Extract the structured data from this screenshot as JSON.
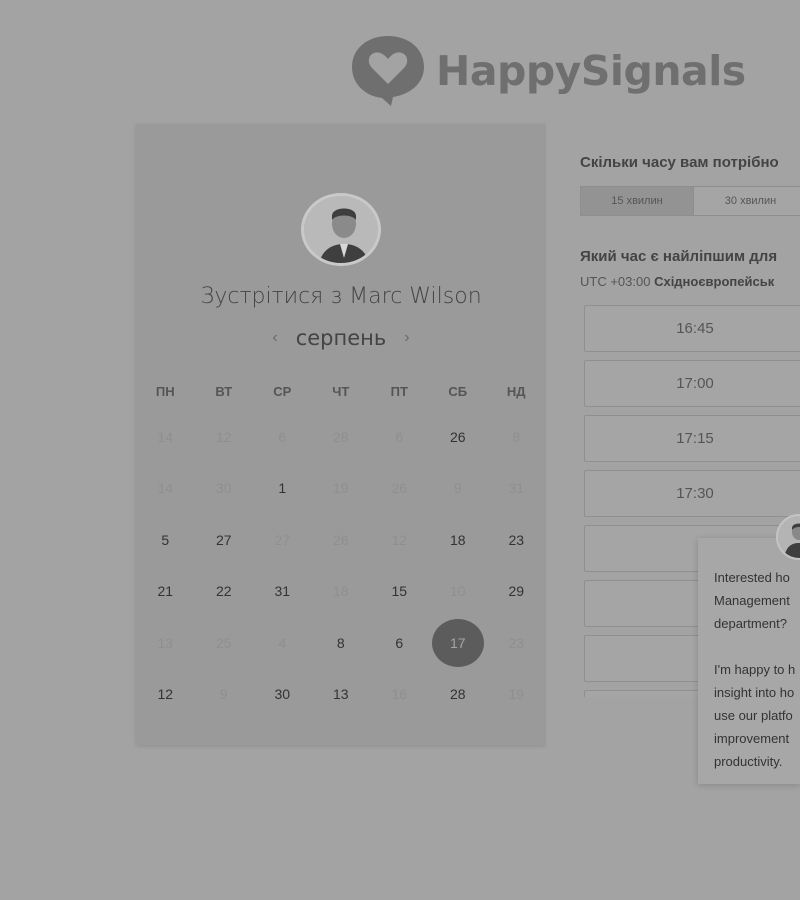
{
  "brand": {
    "name": "HappySignals"
  },
  "booking": {
    "title": "Зустрітися з Marc Wilson",
    "month": "серпень",
    "prev_icon": "chevron-left-icon",
    "next_icon": "chevron-right-icon",
    "weekdays": [
      "ПН",
      "ВТ",
      "СР",
      "ЧТ",
      "ПТ",
      "СБ",
      "НД"
    ],
    "weeks": [
      [
        {
          "d": "14",
          "s": "muted"
        },
        {
          "d": "12",
          "s": "muted"
        },
        {
          "d": "6",
          "s": "muted"
        },
        {
          "d": "28",
          "s": "muted"
        },
        {
          "d": "6",
          "s": "muted"
        },
        {
          "d": "26",
          "s": "active"
        },
        {
          "d": "8",
          "s": "muted"
        }
      ],
      [
        {
          "d": "14",
          "s": "muted"
        },
        {
          "d": "30",
          "s": "muted"
        },
        {
          "d": "1",
          "s": "active"
        },
        {
          "d": "19",
          "s": "muted"
        },
        {
          "d": "26",
          "s": "muted"
        },
        {
          "d": "9",
          "s": "muted"
        },
        {
          "d": "31",
          "s": "muted"
        }
      ],
      [
        {
          "d": "5",
          "s": "active"
        },
        {
          "d": "27",
          "s": "active"
        },
        {
          "d": "27",
          "s": "muted"
        },
        {
          "d": "26",
          "s": "muted"
        },
        {
          "d": "12",
          "s": "muted"
        },
        {
          "d": "18",
          "s": "active"
        },
        {
          "d": "23",
          "s": "active"
        }
      ],
      [
        {
          "d": "21",
          "s": "active"
        },
        {
          "d": "22",
          "s": "active"
        },
        {
          "d": "31",
          "s": "active"
        },
        {
          "d": "18",
          "s": "muted"
        },
        {
          "d": "15",
          "s": "active"
        },
        {
          "d": "10",
          "s": "muted"
        },
        {
          "d": "29",
          "s": "active"
        }
      ],
      [
        {
          "d": "13",
          "s": "muted"
        },
        {
          "d": "25",
          "s": "muted"
        },
        {
          "d": "4",
          "s": "muted"
        },
        {
          "d": "8",
          "s": "active"
        },
        {
          "d": "6",
          "s": "active"
        },
        {
          "d": "17",
          "s": "selected"
        },
        {
          "d": "23",
          "s": "muted"
        }
      ],
      [
        {
          "d": "12",
          "s": "active"
        },
        {
          "d": "9",
          "s": "muted"
        },
        {
          "d": "30",
          "s": "active"
        },
        {
          "d": "13",
          "s": "active"
        },
        {
          "d": "16",
          "s": "muted"
        },
        {
          "d": "28",
          "s": "active"
        },
        {
          "d": "19",
          "s": "muted"
        }
      ]
    ]
  },
  "schedule": {
    "duration_question": "Скільки часу вам потрібно",
    "durations": [
      "15 хвилин",
      "30 хвилин"
    ],
    "selected_duration": 0,
    "time_question": "Який час є найліпшим для",
    "timezone_offset": "UTC +03:00",
    "timezone_name": "Східноєвропейськ",
    "slots": [
      "16:45",
      "17:00",
      "17:15",
      "17:30",
      "",
      "",
      "",
      ""
    ]
  },
  "chat": {
    "lines": [
      "Interested ho",
      "Management",
      "department?",
      "",
      "I'm happy to h",
      "insight into ho",
      "use our platfo",
      "improvement",
      "productivity."
    ]
  },
  "colors": {
    "selected_day": "#5c5c5c",
    "overlay": "#a3a3a3"
  }
}
